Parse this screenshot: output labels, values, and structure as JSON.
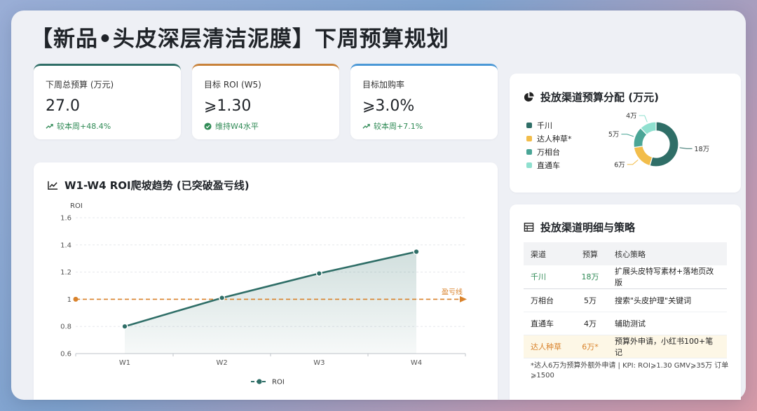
{
  "title": "【新品•头皮深层清洁泥膜】下周预算规划",
  "kpis": [
    {
      "label": "下周总预算 (万元)",
      "value": "27.0",
      "sub": "较本周+48.4%",
      "sub_icon": "trend-up-icon",
      "accent": "#2f6e67"
    },
    {
      "label": "目标 ROI (W5)",
      "value": "⩾1.30",
      "sub": "维持W4水平",
      "sub_icon": "check-circle-icon",
      "accent": "#c8823a"
    },
    {
      "label": "目标加购率",
      "value": "⩾3.0%",
      "sub": "较本周+7.1%",
      "sub_icon": "trend-up-icon",
      "accent": "#4a98d6"
    }
  ],
  "trend": {
    "title": "W1-W4 ROI爬坡趋势 (已突破盈亏线)",
    "ylabel": "ROI",
    "breakeven_label": "盈亏线",
    "legend_label": "ROI"
  },
  "chart_data": [
    {
      "type": "line",
      "title": "W1-W4 ROI爬坡趋势 (已突破盈亏线)",
      "ylabel": "ROI",
      "x": [
        "W1",
        "W2",
        "W3",
        "W4"
      ],
      "series": [
        {
          "name": "ROI",
          "values": [
            0.8,
            1.01,
            1.19,
            1.35
          ],
          "color": "#2f6e67"
        }
      ],
      "reference_line": {
        "name": "盈亏线",
        "value": 1,
        "color": "#d9822b"
      },
      "ylim": [
        0.6,
        1.6
      ],
      "yticks": [
        0.6,
        0.8,
        1,
        1.2,
        1.4,
        1.6
      ],
      "grid": true,
      "legend": "bottom"
    },
    {
      "type": "pie",
      "title": "投放渠道预算分配 (万元)",
      "labels": [
        "千川",
        "达人种草*",
        "万相台",
        "直通车"
      ],
      "values": [
        18,
        6,
        5,
        4
      ],
      "value_labels": [
        "18万",
        "6万",
        "5万",
        "4万"
      ],
      "colors": [
        "#2f6e67",
        "#f2bd4b",
        "#4aa596",
        "#8fe0cf"
      ],
      "legend": "left"
    }
  ],
  "donut": {
    "title": "投放渠道预算分配 (万元)",
    "legend": [
      "千川",
      "达人种草*",
      "万相台",
      "直通车"
    ]
  },
  "channel_table": {
    "title": "投放渠道明细与策略",
    "headers": [
      "渠道",
      "预算",
      "核心策略"
    ],
    "rows": [
      {
        "channel": "千川",
        "budget": "18万",
        "strategy": "扩展头皮特写素材+落地页改版"
      },
      {
        "channel": "万相台",
        "budget": "5万",
        "strategy": "搜索\"头皮护理\"关键词"
      },
      {
        "channel": "直通车",
        "budget": "4万",
        "strategy": "辅助测试"
      },
      {
        "channel": "达人种草",
        "budget": "6万*",
        "strategy": "预算外申请，小红书100+笔记"
      }
    ],
    "footnote": "*达人6万为预算外额外申请 | KPI: ROI⩾1.30 GMV⩾35万 订单⩾1500"
  }
}
